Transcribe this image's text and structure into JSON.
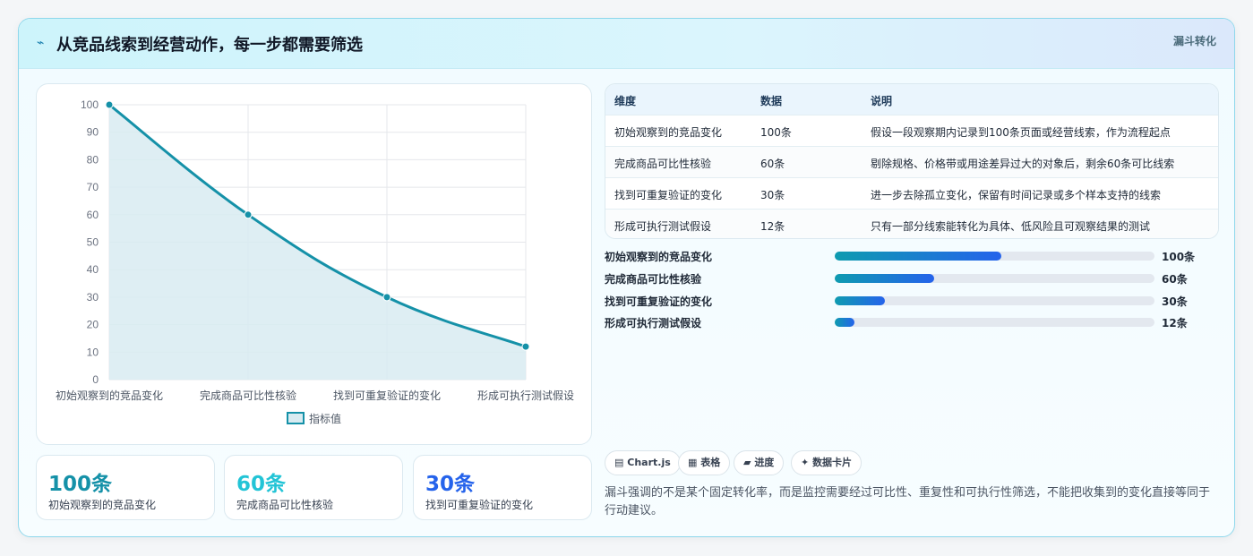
{
  "header": {
    "icon": "⌁",
    "title": "从竞品线索到经营动作，每一步都需要筛选",
    "tag": "漏斗转化"
  },
  "chart_data": {
    "type": "line",
    "categories": [
      "初始观察到的竞品变化",
      "完成商品可比性核验",
      "找到可重复验证的变化",
      "形成可执行测试假设"
    ],
    "series": [
      {
        "name": "指标值",
        "values": [
          100,
          60,
          30,
          12
        ]
      }
    ],
    "ylim": [
      0,
      100
    ],
    "yticks": [
      0,
      10,
      20,
      30,
      40,
      50,
      60,
      70,
      80,
      90,
      100
    ],
    "grid": true,
    "fill": true,
    "legend_position": "bottom",
    "colors": {
      "line": "#1591a8",
      "fill": "#d8ebf1"
    }
  },
  "kpis": [
    {
      "value": "100条",
      "label": "初始观察到的竞品变化",
      "color": "#1591a8"
    },
    {
      "value": "60条",
      "label": "完成商品可比性核验",
      "color": "#22c4d6"
    },
    {
      "value": "30条",
      "label": "找到可重复验证的变化",
      "color": "#2563eb"
    }
  ],
  "table": {
    "headers": [
      "维度",
      "数据",
      "说明"
    ],
    "rows": [
      [
        "初始观察到的竞品变化",
        "100条",
        "假设一段观察期内记录到100条页面或经营线索，作为流程起点"
      ],
      [
        "完成商品可比性核验",
        "60条",
        "剔除规格、价格带或用途差异过大的对象后，剩余60条可比线索"
      ],
      [
        "找到可重复验证的变化",
        "30条",
        "进一步去除孤立变化，保留有时间记录或多个样本支持的线索"
      ],
      [
        "形成可执行测试假设",
        "12条",
        "只有一部分线索能转化为具体、低风险且可观察结果的测试"
      ]
    ]
  },
  "progress": [
    {
      "label": "初始观察到的竞品变化",
      "value": "100条",
      "fraction": 0.52
    },
    {
      "label": "完成商品可比性核验",
      "value": "60条",
      "fraction": 0.31
    },
    {
      "label": "找到可重复验证的变化",
      "value": "30条",
      "fraction": 0.156
    },
    {
      "label": "形成可执行测试假设",
      "value": "12条",
      "fraction": 0.062
    }
  ],
  "chips": [
    {
      "icon": "▤",
      "label": "Chart.js"
    },
    {
      "icon": "▦",
      "label": "表格"
    },
    {
      "icon": "▰",
      "label": "进度"
    },
    {
      "icon": "✦",
      "label": "数据卡片"
    }
  ],
  "footnote": "漏斗强调的不是某个固定转化率，而是监控需要经过可比性、重复性和可执行性筛选，不能把收集到的变化直接等同于行动建议。"
}
